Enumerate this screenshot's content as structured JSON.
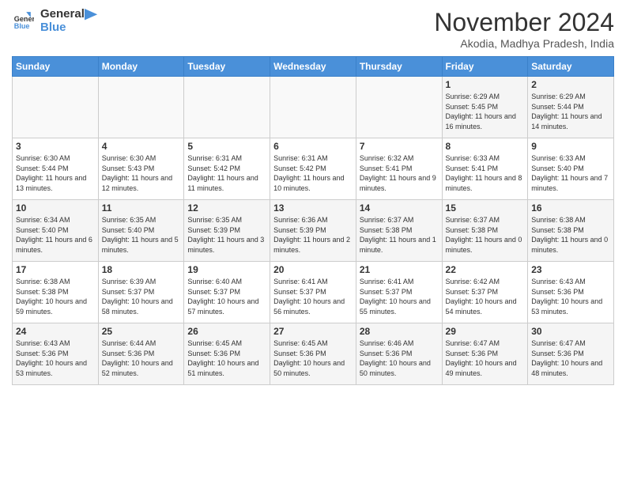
{
  "logo": {
    "line1": "General",
    "line2": "Blue"
  },
  "title": "November 2024",
  "location": "Akodia, Madhya Pradesh, India",
  "days_of_week": [
    "Sunday",
    "Monday",
    "Tuesday",
    "Wednesday",
    "Thursday",
    "Friday",
    "Saturday"
  ],
  "weeks": [
    [
      {
        "day": "",
        "info": ""
      },
      {
        "day": "",
        "info": ""
      },
      {
        "day": "",
        "info": ""
      },
      {
        "day": "",
        "info": ""
      },
      {
        "day": "",
        "info": ""
      },
      {
        "day": "1",
        "info": "Sunrise: 6:29 AM\nSunset: 5:45 PM\nDaylight: 11 hours and 16 minutes."
      },
      {
        "day": "2",
        "info": "Sunrise: 6:29 AM\nSunset: 5:44 PM\nDaylight: 11 hours and 14 minutes."
      }
    ],
    [
      {
        "day": "3",
        "info": "Sunrise: 6:30 AM\nSunset: 5:44 PM\nDaylight: 11 hours and 13 minutes."
      },
      {
        "day": "4",
        "info": "Sunrise: 6:30 AM\nSunset: 5:43 PM\nDaylight: 11 hours and 12 minutes."
      },
      {
        "day": "5",
        "info": "Sunrise: 6:31 AM\nSunset: 5:42 PM\nDaylight: 11 hours and 11 minutes."
      },
      {
        "day": "6",
        "info": "Sunrise: 6:31 AM\nSunset: 5:42 PM\nDaylight: 11 hours and 10 minutes."
      },
      {
        "day": "7",
        "info": "Sunrise: 6:32 AM\nSunset: 5:41 PM\nDaylight: 11 hours and 9 minutes."
      },
      {
        "day": "8",
        "info": "Sunrise: 6:33 AM\nSunset: 5:41 PM\nDaylight: 11 hours and 8 minutes."
      },
      {
        "day": "9",
        "info": "Sunrise: 6:33 AM\nSunset: 5:40 PM\nDaylight: 11 hours and 7 minutes."
      }
    ],
    [
      {
        "day": "10",
        "info": "Sunrise: 6:34 AM\nSunset: 5:40 PM\nDaylight: 11 hours and 6 minutes."
      },
      {
        "day": "11",
        "info": "Sunrise: 6:35 AM\nSunset: 5:40 PM\nDaylight: 11 hours and 5 minutes."
      },
      {
        "day": "12",
        "info": "Sunrise: 6:35 AM\nSunset: 5:39 PM\nDaylight: 11 hours and 3 minutes."
      },
      {
        "day": "13",
        "info": "Sunrise: 6:36 AM\nSunset: 5:39 PM\nDaylight: 11 hours and 2 minutes."
      },
      {
        "day": "14",
        "info": "Sunrise: 6:37 AM\nSunset: 5:38 PM\nDaylight: 11 hours and 1 minute."
      },
      {
        "day": "15",
        "info": "Sunrise: 6:37 AM\nSunset: 5:38 PM\nDaylight: 11 hours and 0 minutes."
      },
      {
        "day": "16",
        "info": "Sunrise: 6:38 AM\nSunset: 5:38 PM\nDaylight: 11 hours and 0 minutes."
      }
    ],
    [
      {
        "day": "17",
        "info": "Sunrise: 6:38 AM\nSunset: 5:38 PM\nDaylight: 10 hours and 59 minutes."
      },
      {
        "day": "18",
        "info": "Sunrise: 6:39 AM\nSunset: 5:37 PM\nDaylight: 10 hours and 58 minutes."
      },
      {
        "day": "19",
        "info": "Sunrise: 6:40 AM\nSunset: 5:37 PM\nDaylight: 10 hours and 57 minutes."
      },
      {
        "day": "20",
        "info": "Sunrise: 6:41 AM\nSunset: 5:37 PM\nDaylight: 10 hours and 56 minutes."
      },
      {
        "day": "21",
        "info": "Sunrise: 6:41 AM\nSunset: 5:37 PM\nDaylight: 10 hours and 55 minutes."
      },
      {
        "day": "22",
        "info": "Sunrise: 6:42 AM\nSunset: 5:37 PM\nDaylight: 10 hours and 54 minutes."
      },
      {
        "day": "23",
        "info": "Sunrise: 6:43 AM\nSunset: 5:36 PM\nDaylight: 10 hours and 53 minutes."
      }
    ],
    [
      {
        "day": "24",
        "info": "Sunrise: 6:43 AM\nSunset: 5:36 PM\nDaylight: 10 hours and 53 minutes."
      },
      {
        "day": "25",
        "info": "Sunrise: 6:44 AM\nSunset: 5:36 PM\nDaylight: 10 hours and 52 minutes."
      },
      {
        "day": "26",
        "info": "Sunrise: 6:45 AM\nSunset: 5:36 PM\nDaylight: 10 hours and 51 minutes."
      },
      {
        "day": "27",
        "info": "Sunrise: 6:45 AM\nSunset: 5:36 PM\nDaylight: 10 hours and 50 minutes."
      },
      {
        "day": "28",
        "info": "Sunrise: 6:46 AM\nSunset: 5:36 PM\nDaylight: 10 hours and 50 minutes."
      },
      {
        "day": "29",
        "info": "Sunrise: 6:47 AM\nSunset: 5:36 PM\nDaylight: 10 hours and 49 minutes."
      },
      {
        "day": "30",
        "info": "Sunrise: 6:47 AM\nSunset: 5:36 PM\nDaylight: 10 hours and 48 minutes."
      }
    ]
  ]
}
